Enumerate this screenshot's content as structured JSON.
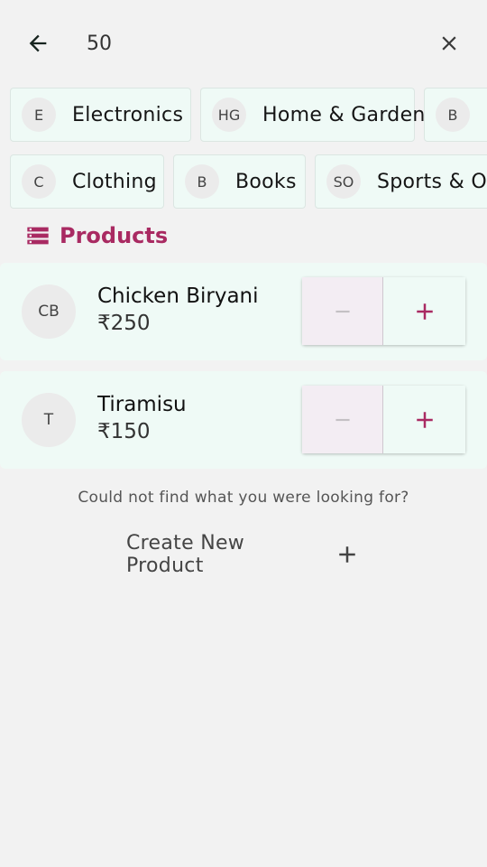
{
  "header": {
    "search_value": "50",
    "back_icon": "arrow-left-icon",
    "close_icon": "close-icon"
  },
  "categories": {
    "row1": [
      {
        "initials": "E",
        "label": "Electronics"
      },
      {
        "initials": "HG",
        "label": "Home & Garden"
      },
      {
        "initials": "B",
        "label": ""
      }
    ],
    "row2": [
      {
        "initials": "C",
        "label": "Clothing"
      },
      {
        "initials": "B",
        "label": "Books"
      },
      {
        "initials": "SO",
        "label": "Sports & Outdoors"
      }
    ]
  },
  "products_section": {
    "title": "Products",
    "icon": "storage-icon"
  },
  "products": [
    {
      "initials": "CB",
      "name": "Chicken Biryani",
      "price": "₹250"
    },
    {
      "initials": "T",
      "name": "Tiramisu",
      "price": "₹150"
    }
  ],
  "footer": {
    "not_found_text": "Could not find what you were looking for?",
    "create_label": "Create New Product"
  },
  "colors": {
    "accent": "#a92a62",
    "card_bg": "#effaf6",
    "background": "#f2f2f2"
  }
}
